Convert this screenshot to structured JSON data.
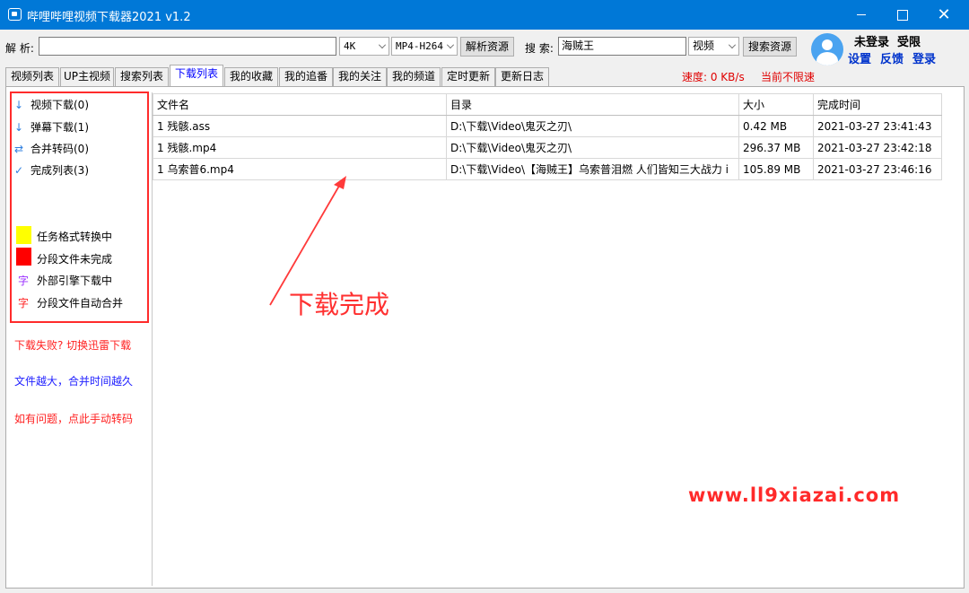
{
  "window": {
    "title": "哔哩哔哩视频下载器2021 v1.2"
  },
  "toolbar": {
    "parse_label": "解 析:",
    "parse_value": "",
    "quality_value": "4K",
    "format_value": "MP4-H264",
    "parse_button": "解析资源",
    "search_label": "搜 索:",
    "search_value": "海贼王",
    "search_type_value": "视频",
    "search_button": "搜索资源"
  },
  "account": {
    "status": "未登录",
    "privilege": "受限",
    "settings_link": "设置",
    "feedback_link": "反馈",
    "login_link": "登录"
  },
  "tabs": [
    {
      "label": "视频列表"
    },
    {
      "label": "UP主视频"
    },
    {
      "label": "搜索列表"
    },
    {
      "label": "下载列表",
      "active": true
    },
    {
      "label": "我的收藏"
    },
    {
      "label": "我的追番"
    },
    {
      "label": "我的关注"
    },
    {
      "label": "我的频道"
    },
    {
      "label": "定时更新"
    },
    {
      "label": "更新日志"
    }
  ],
  "status": {
    "speed": "速度: 0 KB/s",
    "limit": "当前不限速"
  },
  "sidebar": {
    "items": [
      {
        "label": "视频下载(0)",
        "icon": "arrow-down-icon"
      },
      {
        "label": "弹幕下载(1)",
        "icon": "arrow-down-icon"
      },
      {
        "label": "合并转码(0)",
        "icon": "swap-icon"
      },
      {
        "label": "完成列表(3)",
        "icon": "check-icon"
      }
    ],
    "legend": [
      {
        "label": "任务格式转换中",
        "color": "#ffff00"
      },
      {
        "label": "分段文件未完成",
        "color": "#ff0000"
      },
      {
        "label": "外部引擎下载中",
        "char": "字",
        "color": "#9b30ff"
      },
      {
        "label": "分段文件自动合并",
        "char": "字",
        "color": "#ff2020"
      }
    ],
    "tips": [
      {
        "label": "下载失败? 切换迅雷下载",
        "color": "#ff2020"
      },
      {
        "label": "文件越大，合并时间越久",
        "color": "#2020ff"
      },
      {
        "label": "如有问题，点此手动转码",
        "color": "#ff2020"
      }
    ]
  },
  "table": {
    "columns": [
      "文件名",
      "目录",
      "大小",
      "完成时间"
    ],
    "rows": [
      [
        "1 残骸.ass",
        "D:\\下载\\Video\\鬼灭之刃\\",
        "0.42 MB",
        "2021-03-27 23:41:43"
      ],
      [
        "1 残骸.mp4",
        "D:\\下载\\Video\\鬼灭之刃\\",
        "296.37 MB",
        "2021-03-27 23:42:18"
      ],
      [
        "1 乌索普6.mp4",
        "D:\\下载\\Video\\【海贼王】乌索普泪燃 人们皆知三大战力 i",
        "105.89 MB",
        "2021-03-27 23:46:16"
      ]
    ]
  },
  "annotation": {
    "text": "下载完成"
  },
  "watermark": {
    "text": "www.ll9xiazai.com"
  }
}
